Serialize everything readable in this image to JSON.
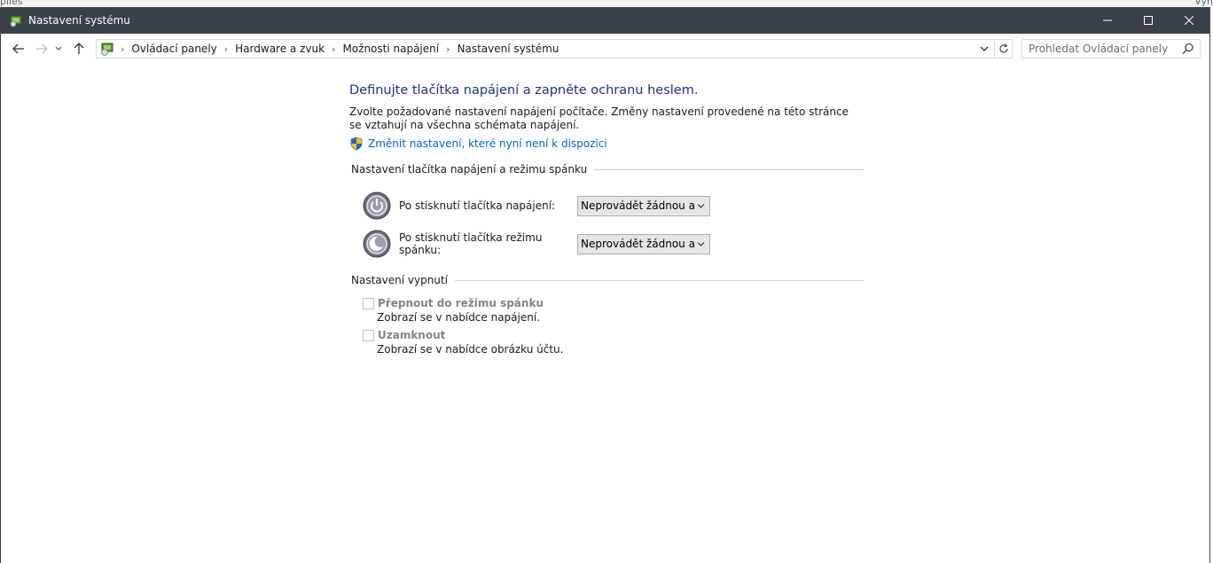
{
  "background": {
    "left_text": "piles",
    "right_text": "Vyh"
  },
  "window": {
    "title": "Nastavení systému"
  },
  "breadcrumb": [
    {
      "label": "Ovládací panely"
    },
    {
      "label": "Hardware a zvuk"
    },
    {
      "label": "Možnosti napájení"
    },
    {
      "label": "Nastavení systému"
    }
  ],
  "search": {
    "placeholder": "Prohledat Ovládací panely"
  },
  "main": {
    "heading": "Definujte tlačítka napájení a zapněte ochranu heslem.",
    "description": "Zvolte požadované nastavení napájení počítače. Změny nastavení provedené na této stránce se vztahují na všechna schémata napájení.",
    "change_link": "Změnit nastavení, které nyní není k dispozici",
    "power_group_title": "Nastavení tlačítka napájení a režimu spánku",
    "power_button_label": "Po stisknutí tlačítka napájení:",
    "power_button_value": "Neprovádět žádnou akci",
    "sleep_button_label": "Po stisknutí tlačítka režimu spánku:",
    "sleep_button_value": "Neprovádět žádnou akci",
    "shutdown_group_title": "Nastavení vypnutí",
    "sleep_option_label": "Přepnout do režimu spánku",
    "sleep_option_desc": "Zobrazí se v nabídce napájení.",
    "lock_option_label": "Uzamknout",
    "lock_option_desc": "Zobrazí se v nabídce obrázku účtu."
  },
  "colors": {
    "titlebar": "#3b414a",
    "heading": "#1e3287",
    "link": "#0066cc"
  }
}
